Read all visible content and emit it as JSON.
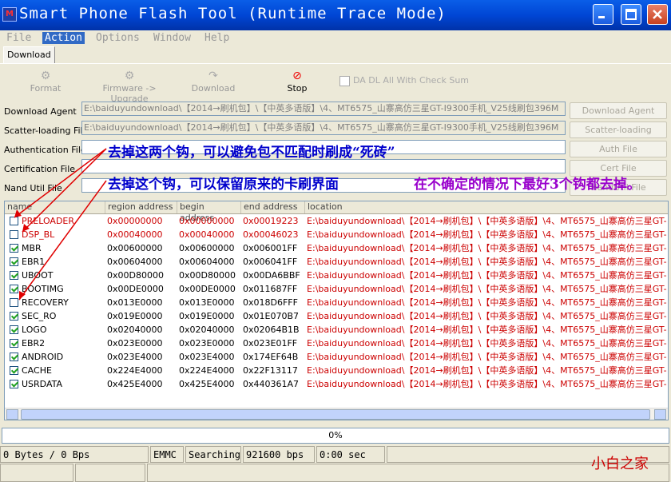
{
  "window": {
    "title": "Smart Phone Flash Tool (Runtime Trace Mode)",
    "icon_text": "M"
  },
  "menu": {
    "items": [
      "File",
      "Action",
      "Options",
      "Window",
      "Help"
    ]
  },
  "tabs": [
    "Download"
  ],
  "toolbar": {
    "format": "Format",
    "firmware_upgrade": "Firmware -> Upgrade",
    "download": "Download",
    "stop": "Stop",
    "da_dl_check": "DA DL All With Check Sum"
  },
  "files": {
    "download_agent": {
      "label": "Download Agent",
      "value": "E:\\baiduyundownload\\【2014→刷机包】\\【中英多语版】\\4、MT6575_山寨高仿三星GT-I9300手机_V25线刷包396M（",
      "button": "Download Agent"
    },
    "scatter": {
      "label": "Scatter-loading File",
      "value": "E:\\baiduyundownload\\【2014→刷机包】\\【中英多语版】\\4、MT6575_山寨高仿三星GT-I9300手机_V25线刷包396M（",
      "button": "Scatter-loading"
    },
    "auth": {
      "label": "Authentication File",
      "value": "",
      "button": "Auth File"
    },
    "cert": {
      "label": "Certification File",
      "value": "",
      "button": "Cert File"
    },
    "nand": {
      "label": "Nand Util File",
      "value": "",
      "button": "NandUtil File"
    }
  },
  "annotations": {
    "a1": "去掉这两个钩，可以避免包不匹配时刷成“死砖”",
    "a2": "去掉这个钩，可以保留原来的卡刷界面",
    "a3": "在不确定的情况下最好3个钩都去掉。"
  },
  "table": {
    "headers": [
      "name",
      "region address",
      "begin address",
      "end address",
      "location"
    ],
    "rows": [
      {
        "checked": false,
        "red": true,
        "name": "PRELOADER",
        "region": "0x00000000",
        "begin": "0x00000000",
        "end": "0x00019223",
        "location": "E:\\baiduyundownload\\【2014→刷机包】\\【中英多语版】\\4、MT6575_山寨高仿三星GT-"
      },
      {
        "checked": false,
        "red": true,
        "name": "DSP_BL",
        "region": "0x00040000",
        "begin": "0x00040000",
        "end": "0x00046023",
        "location": "E:\\baiduyundownload\\【2014→刷机包】\\【中英多语版】\\4、MT6575_山寨高仿三星GT-"
      },
      {
        "checked": true,
        "red": false,
        "name": "MBR",
        "region": "0x00600000",
        "begin": "0x00600000",
        "end": "0x006001FF",
        "location": "E:\\baiduyundownload\\【2014→刷机包】\\【中英多语版】\\4、MT6575_山寨高仿三星GT-"
      },
      {
        "checked": true,
        "red": false,
        "name": "EBR1",
        "region": "0x00604000",
        "begin": "0x00604000",
        "end": "0x006041FF",
        "location": "E:\\baiduyundownload\\【2014→刷机包】\\【中英多语版】\\4、MT6575_山寨高仿三星GT-"
      },
      {
        "checked": true,
        "red": false,
        "name": "UBOOT",
        "region": "0x00D80000",
        "begin": "0x00D80000",
        "end": "0x00DA6BBF",
        "location": "E:\\baiduyundownload\\【2014→刷机包】\\【中英多语版】\\4、MT6575_山寨高仿三星GT-"
      },
      {
        "checked": true,
        "red": false,
        "name": "BOOTIMG",
        "region": "0x00DE0000",
        "begin": "0x00DE0000",
        "end": "0x011687FF",
        "location": "E:\\baiduyundownload\\【2014→刷机包】\\【中英多语版】\\4、MT6575_山寨高仿三星GT-"
      },
      {
        "checked": false,
        "red": false,
        "name": "RECOVERY",
        "region": "0x013E0000",
        "begin": "0x013E0000",
        "end": "0x018D6FFF",
        "location": "E:\\baiduyundownload\\【2014→刷机包】\\【中英多语版】\\4、MT6575_山寨高仿三星GT-"
      },
      {
        "checked": true,
        "red": false,
        "name": "SEC_RO",
        "region": "0x019E0000",
        "begin": "0x019E0000",
        "end": "0x01E070B7",
        "location": "E:\\baiduyundownload\\【2014→刷机包】\\【中英多语版】\\4、MT6575_山寨高仿三星GT-"
      },
      {
        "checked": true,
        "red": false,
        "name": "LOGO",
        "region": "0x02040000",
        "begin": "0x02040000",
        "end": "0x02064B1B",
        "location": "E:\\baiduyundownload\\【2014→刷机包】\\【中英多语版】\\4、MT6575_山寨高仿三星GT-"
      },
      {
        "checked": true,
        "red": false,
        "name": "EBR2",
        "region": "0x023E0000",
        "begin": "0x023E0000",
        "end": "0x023E01FF",
        "location": "E:\\baiduyundownload\\【2014→刷机包】\\【中英多语版】\\4、MT6575_山寨高仿三星GT-"
      },
      {
        "checked": true,
        "red": false,
        "name": "ANDROID",
        "region": "0x023E4000",
        "begin": "0x023E4000",
        "end": "0x174EF64B",
        "location": "E:\\baiduyundownload\\【2014→刷机包】\\【中英多语版】\\4、MT6575_山寨高仿三星GT-"
      },
      {
        "checked": true,
        "red": false,
        "name": "CACHE",
        "region": "0x224E4000",
        "begin": "0x224E4000",
        "end": "0x22F13117",
        "location": "E:\\baiduyundownload\\【2014→刷机包】\\【中英多语版】\\4、MT6575_山寨高仿三星GT-"
      },
      {
        "checked": true,
        "red": false,
        "name": "USRDATA",
        "region": "0x425E4000",
        "begin": "0x425E4000",
        "end": "0x440361A7",
        "location": "E:\\baiduyundownload\\【2014→刷机包】\\【中英多语版】\\4、MT6575_山寨高仿三星GT-"
      }
    ]
  },
  "progress": {
    "text": "0%",
    "value": 0
  },
  "status": {
    "bytes": "0 Bytes / 0 Bps",
    "storage": "EMMC",
    "state": "Searching",
    "baud": "921600 bps",
    "time": "0:00 sec"
  },
  "watermark": "小白之家",
  "colors": {
    "titlebar": "#0046D5",
    "annotation_blue": "#0000CC",
    "annotation_purple": "#9900CC",
    "red_text": "#CC0000",
    "check_green": "#21A121"
  }
}
